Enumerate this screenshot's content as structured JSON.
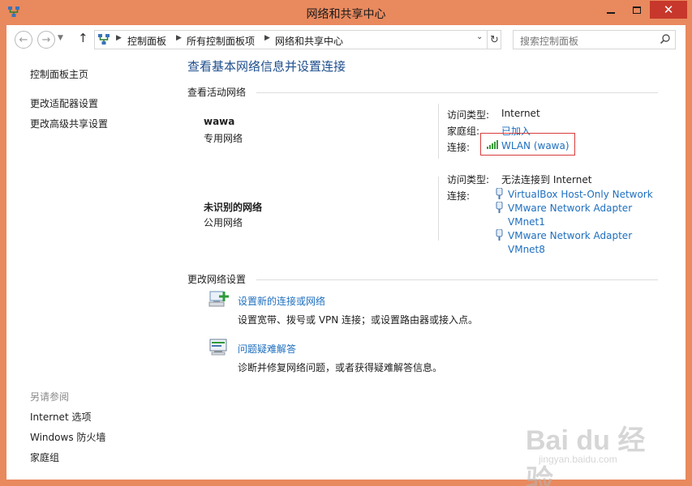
{
  "window": {
    "title": "网络和共享中心",
    "close_label": "✕"
  },
  "nav": {
    "breadcrumbs": [
      "控制面板",
      "所有控制面板项",
      "网络和共享中心"
    ],
    "search_placeholder": "搜索控制面板"
  },
  "sidebar": {
    "home": "控制面板主页",
    "links": [
      "更改适配器设置",
      "更改高级共享设置"
    ],
    "see_also_heading": "另请参阅",
    "see_also": [
      "Internet 选项",
      "Windows 防火墙",
      "家庭组"
    ]
  },
  "main": {
    "title": "查看基本网络信息并设置连接",
    "active_heading": "查看活动网络",
    "networks": [
      {
        "name": "wawa",
        "type": "专用网络",
        "access_label": "访问类型:",
        "access_value": "Internet",
        "homegroup_label": "家庭组:",
        "homegroup_value": "已加入",
        "connection_label": "连接:",
        "connection_value": "WLAN (wawa)"
      },
      {
        "name": "未识别的网络",
        "type": "公用网络",
        "access_label": "访问类型:",
        "access_value": "无法连接到 Internet",
        "connection_label": "连接:",
        "connections": [
          [
            "VirtualBox Host-Only Network"
          ],
          [
            "VMware Network Adapter",
            "VMnet1"
          ],
          [
            "VMware Network Adapter",
            "VMnet8"
          ]
        ]
      }
    ],
    "change_heading": "更改网络设置",
    "tasks": [
      {
        "link": "设置新的连接或网络",
        "desc": "设置宽带、拨号或 VPN 连接；或设置路由器或接入点。"
      },
      {
        "link": "问题疑难解答",
        "desc": "诊断并修复网络问题，或者获得疑难解答信息。"
      }
    ]
  },
  "watermark": {
    "main": "Bai du 经验",
    "sub": "jingyan.baidu.com"
  },
  "colors": {
    "frame": "#e9895e",
    "link": "#1e6fbf",
    "title": "#1e4e8c",
    "close": "#c7372b",
    "highlight": "#d83c3c"
  }
}
